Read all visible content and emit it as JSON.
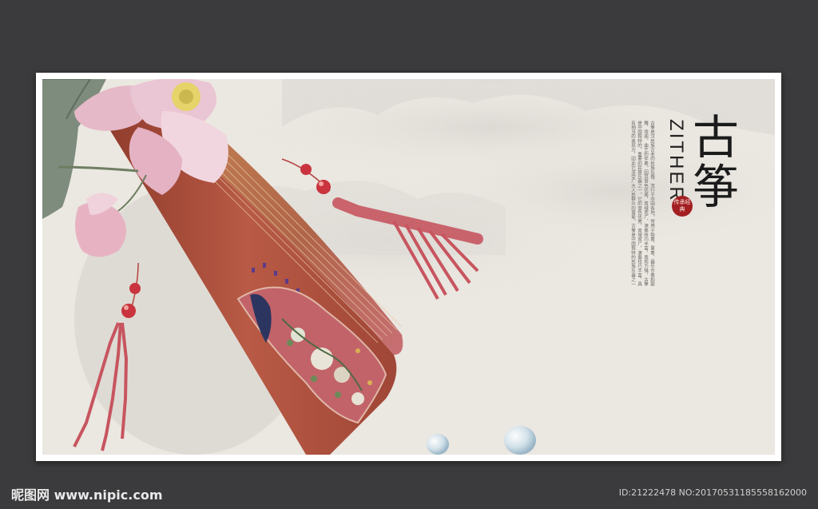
{
  "poster": {
    "title_cjk": "古筝",
    "title_en": "ZITHER",
    "seal_text": "传承经典",
    "body_text": "古筝是汉民族古老的民族乐器，流行于中国各地。常用于独奏、重奏、器乐合奏和歌舞、戏曲、曲艺的伴奏。因其音色优美，音域宽广、演奏技巧丰富，表现力强，古筝是中国独特的、重要的民族乐器之一。它的音色优美，音域宽广，演奏技巧丰富，具有相当的表现力，因此它深受广大人民群众的喜爱。古筝是中国独特的民族乐器之一"
  },
  "footer": {
    "logo": "昵图网 www.nipic.com",
    "id_text": "ID:21222478 NO:20170531185558162000"
  },
  "colors": {
    "background": "#3b3b3d",
    "poster_bg": "#ebe7e1",
    "zither_wood": "#a94a3a",
    "tassel": "#c7555f",
    "seal": "#a31f22"
  }
}
